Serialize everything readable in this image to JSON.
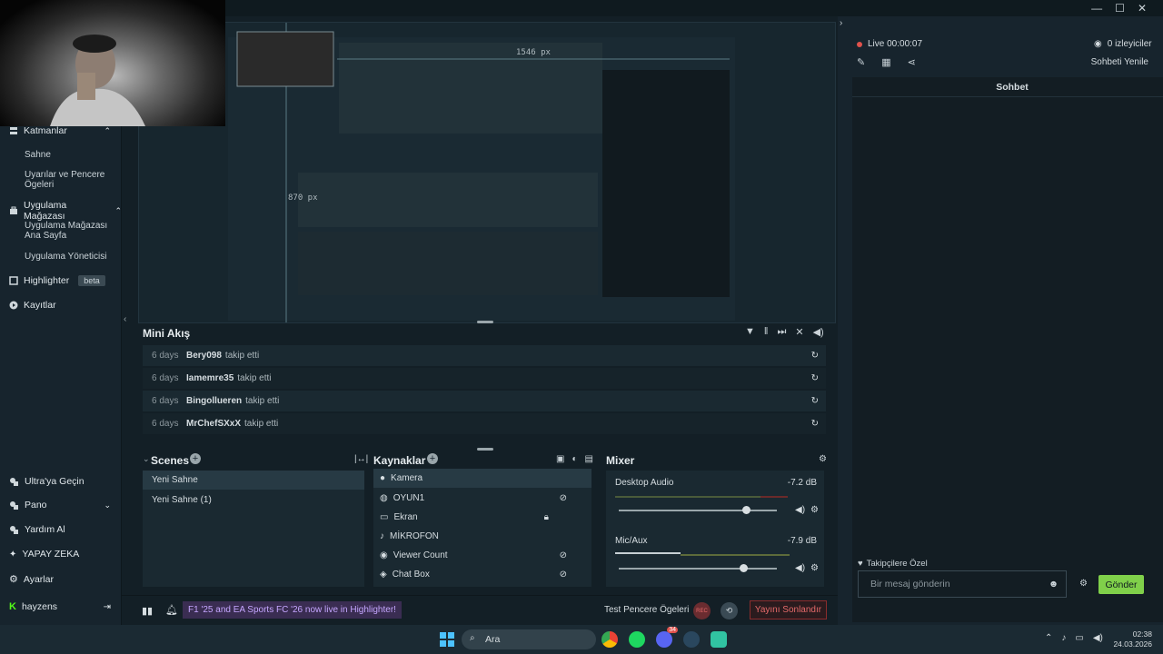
{
  "window": {
    "minimize": "—",
    "maximize": "☐",
    "close": "✕"
  },
  "sidebar": {
    "layers": "Katmanlar",
    "scene": "Sahne",
    "widgets": "Uyarılar ve Pencere Ögeleri",
    "app_store": "Uygulama Mağazası",
    "app_store_home": "Uygulama Mağazası Ana Sayfa",
    "app_manager": "Uygulama Yöneticisi",
    "highlighter": "Highlighter",
    "beta": "beta",
    "recordings": "Kayıtlar",
    "ultra": "Ultra'ya Geçin",
    "dashboard": "Pano",
    "help": "Yardım Al",
    "ai": "YAPAY ZEKA",
    "settings": "Ayarlar",
    "user": "hayzens"
  },
  "preview": {
    "width_label": "1546 px",
    "height_label": "870 px",
    "inner_chat_title": "Sohbet"
  },
  "mini_feed": {
    "title": "Mini Akış",
    "items": [
      {
        "time": "6 days",
        "user": "Bery098",
        "action": "takip etti"
      },
      {
        "time": "6 days",
        "user": "Iamemre35",
        "action": "takip etti"
      },
      {
        "time": "6 days",
        "user": "Bingollueren",
        "action": "takip etti"
      },
      {
        "time": "6 days",
        "user": "MrChefSXxX",
        "action": "takip etti"
      }
    ]
  },
  "scenes": {
    "title": "Scenes",
    "items": [
      "Yeni Sahne",
      "Yeni Sahne (1)"
    ]
  },
  "sources": {
    "title": "Kaynaklar",
    "items": [
      "Kamera",
      "OYUN1",
      "Ekran",
      "MİKROFON",
      "Viewer Count",
      "Chat Box"
    ]
  },
  "mixer": {
    "title": "Mixer",
    "channels": [
      {
        "name": "Desktop Audio",
        "db": "-7.2 dB",
        "level": 0.88
      },
      {
        "name": "Mic/Aux",
        "db": "-7.9 dB",
        "level": 0.85
      }
    ]
  },
  "bottom": {
    "banner": "F1 '25 and EA Sports FC '26 now live in Highlighter!",
    "test_widgets": "Test Pencere Ögeleri",
    "rec": "REC",
    "end_stream": "Yayını Sonlandır"
  },
  "right": {
    "live": "Live 00:00:07",
    "viewers": "0 izleyiciler",
    "refresh_chat": "Sohbeti Yenile",
    "chat_title": "Sohbet",
    "followers_only": "Takipçilere Özel",
    "chat_placeholder": "Bir mesaj gönderin",
    "send": "Gönder"
  },
  "taskbar": {
    "search": "Ara",
    "time": "02:38",
    "date": "24.03.2026",
    "badge": "34"
  },
  "colors": {
    "accent": "#80d04a",
    "live": "#e0524c",
    "danger": "#e56a6a"
  }
}
